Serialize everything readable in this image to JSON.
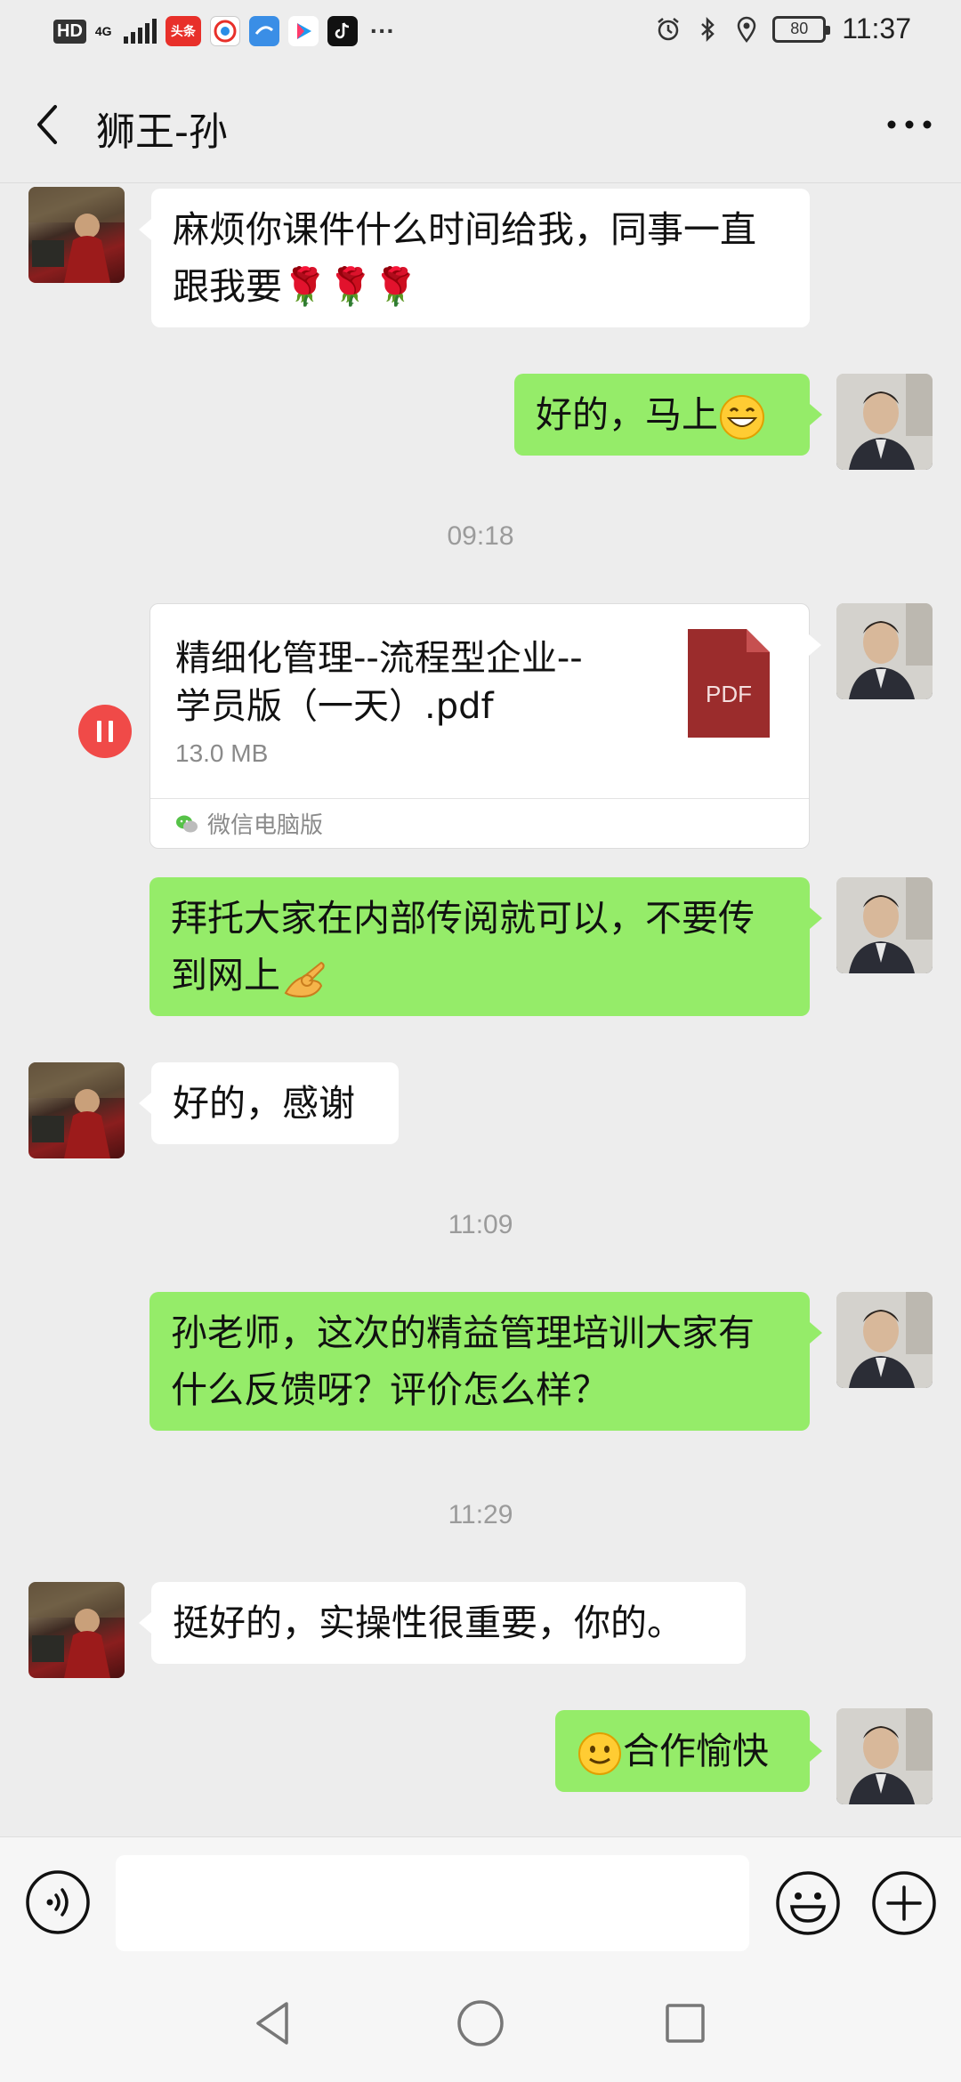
{
  "status_bar": {
    "hd": "HD",
    "network": "4G",
    "battery": "80",
    "time": "11:37",
    "apps": [
      {
        "name": "toutiao",
        "label": "头条",
        "color": "#e8302a"
      },
      {
        "name": "app-2",
        "label": "",
        "color": "#f0f0f0"
      },
      {
        "name": "app-3",
        "label": "",
        "color": "#3a8ee6"
      },
      {
        "name": "youku",
        "label": "",
        "color": "#ffffff"
      },
      {
        "name": "tiktok",
        "label": "",
        "color": "#111111"
      }
    ],
    "overflow": "···"
  },
  "header": {
    "title": "狮王-孙"
  },
  "messages": {
    "m1": "麻烦你课件什么时间给我，同事一直跟我要🌹🌹🌹",
    "m2": "好的，马上",
    "t1": "09:18",
    "file": {
      "name": "精细化管理--流程型企业--学员版（一天）.pdf",
      "size": "13.0 MB",
      "type_label": "PDF",
      "source": "微信电脑版"
    },
    "m3": "拜托大家在内部传阅就可以，不要传到网上",
    "m4": "好的，感谢",
    "t2": "11:09",
    "m5": "孙老师，这次的精益管理培训大家有什么反馈呀？评价怎么样？",
    "t3": "11:29",
    "m6": "挺好的，实操性很重要，你的。",
    "m7": "合作愉快"
  },
  "input": {
    "placeholder": ""
  },
  "colors": {
    "bubble_out": "#95ec69",
    "bubble_in": "#ffffff",
    "background": "#ededed",
    "pause_button": "#f04a48",
    "pdf_icon": "#9b2c2c"
  }
}
